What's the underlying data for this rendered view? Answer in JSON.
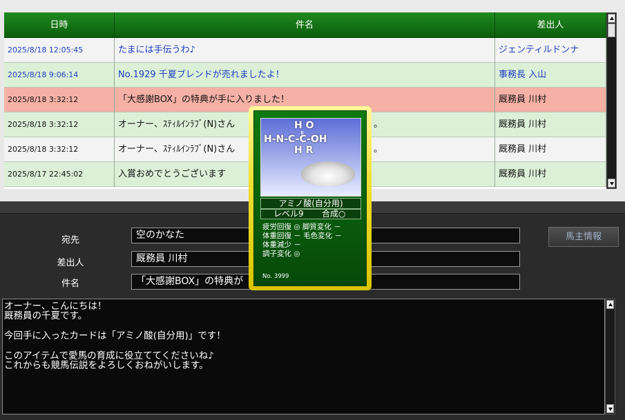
{
  "table": {
    "headers": {
      "date": "日時",
      "subject": "件名",
      "sender": "差出人"
    },
    "rows": [
      {
        "date": "2025/8/18 12:05:45",
        "subject": "たまには手伝うわ♪",
        "sender": "ジェンティルドンナ",
        "bg": "white",
        "text": "blue"
      },
      {
        "date": "2025/8/18 9:06:14",
        "subject": "No.1929 千夏ブレンドが売れましたよ！",
        "sender": "事務長 入山",
        "bg": "green",
        "text": "blue"
      },
      {
        "date": "2025/8/18 3:32:12",
        "subject": "「大感謝BOX」の特典が手に入りました！",
        "sender": "厩務員 川村",
        "bg": "red",
        "text": "black"
      },
      {
        "date": "2025/8/18 3:32:12",
        "subject": "オーナー、ｽﾃｨﾙｲﾝﾗﾌﾞ(N)さん",
        "subject_tail": "。",
        "sender": "厩務員 川村",
        "bg": "green",
        "text": "black"
      },
      {
        "date": "2025/8/18 3:32:12",
        "subject": "オーナー、ｽﾃｨﾙｲﾝﾗﾌﾞ(N)さん",
        "subject_tail": "。",
        "sender": "厩務員 川村",
        "bg": "white",
        "text": "black"
      },
      {
        "date": "2025/8/17 22:45:02",
        "subject": "入賞おめでとうございます",
        "sender": "厩務員 川村",
        "bg": "green",
        "text": "black"
      }
    ]
  },
  "compose": {
    "to_label": "宛先",
    "to_value": "空のかなた",
    "from_label": "差出人",
    "from_value": "厩務員 川村",
    "subject_label": "件名",
    "subject_value": "「大感謝BOX」の特典が",
    "horse_info_button": "馬主情報",
    "body_lines": [
      "オーナー、こんにちは！",
      "厩務員の千夏です。",
      "",
      "今回手に入ったカードは「アミノ酸(自分用)」です！",
      "",
      "このアイテムで愛馬の育成に役立ててくださいね♪",
      "これからも競馬伝説をよろしくおねがいします。"
    ]
  },
  "card": {
    "formula_top": "H O",
    "formula_mid": "H-N-C-C-OH",
    "formula_bot": "H R",
    "name": "アミノ酸(自分用)",
    "level": "レベル9",
    "synthesis": "合成○",
    "stats": [
      "疲労回復 ◎ 脚質変化 －",
      "体重回復 － 毛色変化 －",
      "体重減少 －",
      "調子変化 ◎"
    ],
    "number": "No. 3999"
  },
  "colors": {
    "header_green": "#157515",
    "row_white": "#f3f3f3",
    "row_green": "#dcf0d8",
    "row_red": "#f5b1a6",
    "link_blue": "#1f3fbf",
    "card_gold": "#f0e034",
    "card_green": "#0b5e0b"
  }
}
